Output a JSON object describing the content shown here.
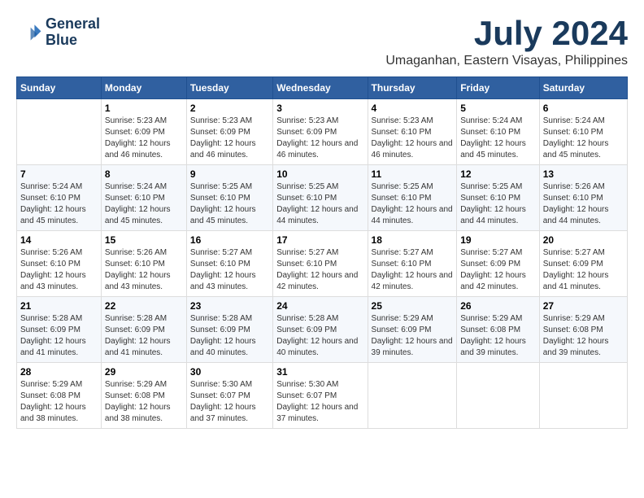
{
  "header": {
    "logo_line1": "General",
    "logo_line2": "Blue",
    "month": "July 2024",
    "location": "Umaganhan, Eastern Visayas, Philippines"
  },
  "columns": [
    "Sunday",
    "Monday",
    "Tuesday",
    "Wednesday",
    "Thursday",
    "Friday",
    "Saturday"
  ],
  "weeks": [
    [
      {
        "day": "",
        "sunrise": "",
        "sunset": "",
        "daylight": ""
      },
      {
        "day": "1",
        "sunrise": "Sunrise: 5:23 AM",
        "sunset": "Sunset: 6:09 PM",
        "daylight": "Daylight: 12 hours and 46 minutes."
      },
      {
        "day": "2",
        "sunrise": "Sunrise: 5:23 AM",
        "sunset": "Sunset: 6:09 PM",
        "daylight": "Daylight: 12 hours and 46 minutes."
      },
      {
        "day": "3",
        "sunrise": "Sunrise: 5:23 AM",
        "sunset": "Sunset: 6:09 PM",
        "daylight": "Daylight: 12 hours and 46 minutes."
      },
      {
        "day": "4",
        "sunrise": "Sunrise: 5:23 AM",
        "sunset": "Sunset: 6:10 PM",
        "daylight": "Daylight: 12 hours and 46 minutes."
      },
      {
        "day": "5",
        "sunrise": "Sunrise: 5:24 AM",
        "sunset": "Sunset: 6:10 PM",
        "daylight": "Daylight: 12 hours and 45 minutes."
      },
      {
        "day": "6",
        "sunrise": "Sunrise: 5:24 AM",
        "sunset": "Sunset: 6:10 PM",
        "daylight": "Daylight: 12 hours and 45 minutes."
      }
    ],
    [
      {
        "day": "7",
        "sunrise": "Sunrise: 5:24 AM",
        "sunset": "Sunset: 6:10 PM",
        "daylight": "Daylight: 12 hours and 45 minutes."
      },
      {
        "day": "8",
        "sunrise": "Sunrise: 5:24 AM",
        "sunset": "Sunset: 6:10 PM",
        "daylight": "Daylight: 12 hours and 45 minutes."
      },
      {
        "day": "9",
        "sunrise": "Sunrise: 5:25 AM",
        "sunset": "Sunset: 6:10 PM",
        "daylight": "Daylight: 12 hours and 45 minutes."
      },
      {
        "day": "10",
        "sunrise": "Sunrise: 5:25 AM",
        "sunset": "Sunset: 6:10 PM",
        "daylight": "Daylight: 12 hours and 44 minutes."
      },
      {
        "day": "11",
        "sunrise": "Sunrise: 5:25 AM",
        "sunset": "Sunset: 6:10 PM",
        "daylight": "Daylight: 12 hours and 44 minutes."
      },
      {
        "day": "12",
        "sunrise": "Sunrise: 5:25 AM",
        "sunset": "Sunset: 6:10 PM",
        "daylight": "Daylight: 12 hours and 44 minutes."
      },
      {
        "day": "13",
        "sunrise": "Sunrise: 5:26 AM",
        "sunset": "Sunset: 6:10 PM",
        "daylight": "Daylight: 12 hours and 44 minutes."
      }
    ],
    [
      {
        "day": "14",
        "sunrise": "Sunrise: 5:26 AM",
        "sunset": "Sunset: 6:10 PM",
        "daylight": "Daylight: 12 hours and 43 minutes."
      },
      {
        "day": "15",
        "sunrise": "Sunrise: 5:26 AM",
        "sunset": "Sunset: 6:10 PM",
        "daylight": "Daylight: 12 hours and 43 minutes."
      },
      {
        "day": "16",
        "sunrise": "Sunrise: 5:27 AM",
        "sunset": "Sunset: 6:10 PM",
        "daylight": "Daylight: 12 hours and 43 minutes."
      },
      {
        "day": "17",
        "sunrise": "Sunrise: 5:27 AM",
        "sunset": "Sunset: 6:10 PM",
        "daylight": "Daylight: 12 hours and 42 minutes."
      },
      {
        "day": "18",
        "sunrise": "Sunrise: 5:27 AM",
        "sunset": "Sunset: 6:10 PM",
        "daylight": "Daylight: 12 hours and 42 minutes."
      },
      {
        "day": "19",
        "sunrise": "Sunrise: 5:27 AM",
        "sunset": "Sunset: 6:09 PM",
        "daylight": "Daylight: 12 hours and 42 minutes."
      },
      {
        "day": "20",
        "sunrise": "Sunrise: 5:27 AM",
        "sunset": "Sunset: 6:09 PM",
        "daylight": "Daylight: 12 hours and 41 minutes."
      }
    ],
    [
      {
        "day": "21",
        "sunrise": "Sunrise: 5:28 AM",
        "sunset": "Sunset: 6:09 PM",
        "daylight": "Daylight: 12 hours and 41 minutes."
      },
      {
        "day": "22",
        "sunrise": "Sunrise: 5:28 AM",
        "sunset": "Sunset: 6:09 PM",
        "daylight": "Daylight: 12 hours and 41 minutes."
      },
      {
        "day": "23",
        "sunrise": "Sunrise: 5:28 AM",
        "sunset": "Sunset: 6:09 PM",
        "daylight": "Daylight: 12 hours and 40 minutes."
      },
      {
        "day": "24",
        "sunrise": "Sunrise: 5:28 AM",
        "sunset": "Sunset: 6:09 PM",
        "daylight": "Daylight: 12 hours and 40 minutes."
      },
      {
        "day": "25",
        "sunrise": "Sunrise: 5:29 AM",
        "sunset": "Sunset: 6:09 PM",
        "daylight": "Daylight: 12 hours and 39 minutes."
      },
      {
        "day": "26",
        "sunrise": "Sunrise: 5:29 AM",
        "sunset": "Sunset: 6:08 PM",
        "daylight": "Daylight: 12 hours and 39 minutes."
      },
      {
        "day": "27",
        "sunrise": "Sunrise: 5:29 AM",
        "sunset": "Sunset: 6:08 PM",
        "daylight": "Daylight: 12 hours and 39 minutes."
      }
    ],
    [
      {
        "day": "28",
        "sunrise": "Sunrise: 5:29 AM",
        "sunset": "Sunset: 6:08 PM",
        "daylight": "Daylight: 12 hours and 38 minutes."
      },
      {
        "day": "29",
        "sunrise": "Sunrise: 5:29 AM",
        "sunset": "Sunset: 6:08 PM",
        "daylight": "Daylight: 12 hours and 38 minutes."
      },
      {
        "day": "30",
        "sunrise": "Sunrise: 5:30 AM",
        "sunset": "Sunset: 6:07 PM",
        "daylight": "Daylight: 12 hours and 37 minutes."
      },
      {
        "day": "31",
        "sunrise": "Sunrise: 5:30 AM",
        "sunset": "Sunset: 6:07 PM",
        "daylight": "Daylight: 12 hours and 37 minutes."
      },
      {
        "day": "",
        "sunrise": "",
        "sunset": "",
        "daylight": ""
      },
      {
        "day": "",
        "sunrise": "",
        "sunset": "",
        "daylight": ""
      },
      {
        "day": "",
        "sunrise": "",
        "sunset": "",
        "daylight": ""
      }
    ]
  ]
}
